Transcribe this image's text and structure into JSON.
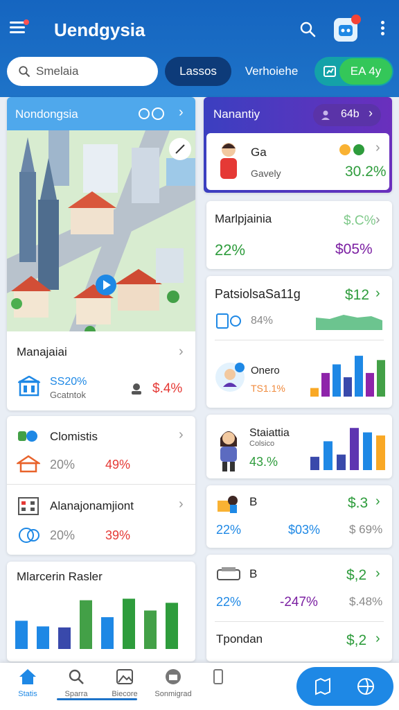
{
  "app": {
    "title": "Uendgysia"
  },
  "colors": {
    "header": "#1565c0",
    "accent_green": "#2e9c3c",
    "accent_red": "#e53935",
    "accent_purple": "#7b1fa2",
    "accent_blue": "#1e88e5"
  },
  "search": {
    "placeholder": "Smelaia"
  },
  "filters": {
    "pill_a": "Lassos",
    "pill_b": "Verhoiehe",
    "pill_c": "EA 4y"
  },
  "map_card": {
    "title": "Nondongsia",
    "section_title": "Manajaiai",
    "stat_a": "SS20%",
    "stat_a_sub": "Gcatntok",
    "stat_b": "$.4%"
  },
  "summary_card": {
    "title": "Nanantiy",
    "pill_value": "64b",
    "person_name": "Ga",
    "person_sub": "Gavely",
    "person_value": "30.2%"
  },
  "card_r2": {
    "title": "Marlpjainia",
    "corner": "$.C%",
    "value_a": "22%",
    "value_b": "$05%"
  },
  "card_r3": {
    "title": "PatsiolsaSa11g",
    "value": "$12",
    "sub_a": "84%",
    "person_name": "Onero",
    "person_sub": "TS1.1%",
    "bars": [
      0.2,
      0.55,
      0.75,
      0.45,
      0.95,
      0.55,
      0.85
    ]
  },
  "card_l2": {
    "row1_title": "Clomistis",
    "row1_a": "20%",
    "row1_b": "49%",
    "row2_title": "Alanajonamjiont",
    "row2_a": "20%",
    "row2_b": "39%"
  },
  "card_r4": {
    "title": "Staiattia",
    "sub": "Colsico",
    "value": "43.%",
    "bars": [
      0.3,
      0.65,
      0.35,
      0.95,
      0.85,
      0.78
    ]
  },
  "card_r5": {
    "title": "B",
    "value": "$.3",
    "stat_a": "22%",
    "stat_b": "$03%",
    "stat_c": "$ 69%"
  },
  "card_l3": {
    "title": "Mlarcerin Rasler",
    "bars": [
      0.55,
      0.44,
      0.42,
      0.95,
      0.62,
      0.98,
      0.75,
      0.9
    ]
  },
  "card_r6": {
    "row1_title": "B",
    "row1_value": "$,2",
    "row1_a": "22%",
    "row1_b": "-247%",
    "row1_c": "$.48%",
    "row2_title": "Tpondan",
    "row2_value": "$,2"
  },
  "bottom_nav": {
    "items": [
      {
        "label": "Statis",
        "icon": "home-icon"
      },
      {
        "label": "Sparra",
        "icon": "search-icon"
      },
      {
        "label": "Biecore",
        "icon": "gallery-icon"
      },
      {
        "label": "Sonmigrad",
        "icon": "briefcase-icon"
      },
      {
        "label": "",
        "icon": "device-icon"
      }
    ]
  }
}
